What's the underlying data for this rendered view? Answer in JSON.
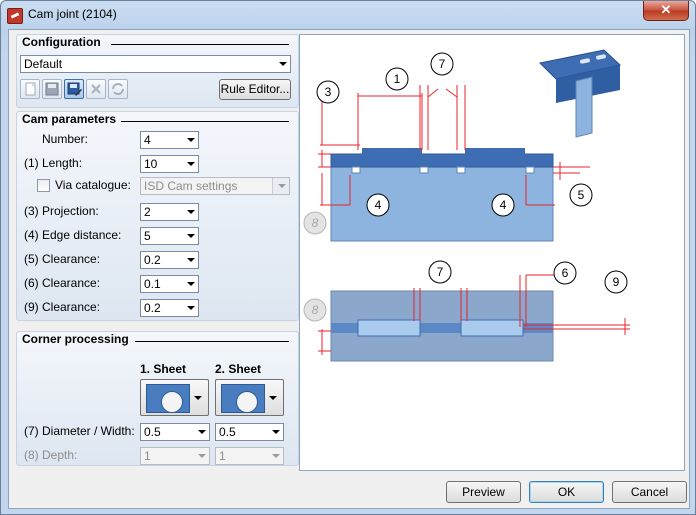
{
  "window": {
    "title": "Cam joint (2104)",
    "close_glyph": "✕"
  },
  "configuration": {
    "title": "Configuration",
    "preset": "Default",
    "rule_editor_label": "Rule Editor..."
  },
  "cam_parameters": {
    "title": "Cam parameters",
    "fields": [
      {
        "label": "Number:",
        "value": "4"
      },
      {
        "label": "(1) Length:",
        "value": "10"
      },
      {
        "label": "Via catalogue:",
        "value": "ISD Cam settings"
      },
      {
        "label": "(3) Projection:",
        "value": "2"
      },
      {
        "label": "(4) Edge distance:",
        "value": "5"
      },
      {
        "label": "(5) Clearance:",
        "value": "0.2"
      },
      {
        "label": "(6) Clearance:",
        "value": "0.1"
      },
      {
        "label": "(9) Clearance:",
        "value": "0.2"
      }
    ]
  },
  "corner_processing": {
    "title": "Corner processing",
    "col1": "1. Sheet",
    "col2": "2. Sheet",
    "diameter_label": "(7) Diameter / Width:",
    "diameter_1": "0.5",
    "diameter_2": "0.5",
    "depth_label": "(8) Depth:",
    "depth_1": "1",
    "depth_2": "1"
  },
  "diagram": {
    "callouts": [
      "1",
      "3",
      "4",
      "4",
      "5",
      "7",
      "7",
      "6",
      "9",
      "8",
      "8"
    ]
  },
  "buttons": {
    "preview": "Preview",
    "ok": "OK",
    "cancel": "Cancel"
  },
  "colors": {
    "sheet_dark": "#3f6db3",
    "sheet_light": "#8db3df",
    "dimension": "#e8232a"
  }
}
